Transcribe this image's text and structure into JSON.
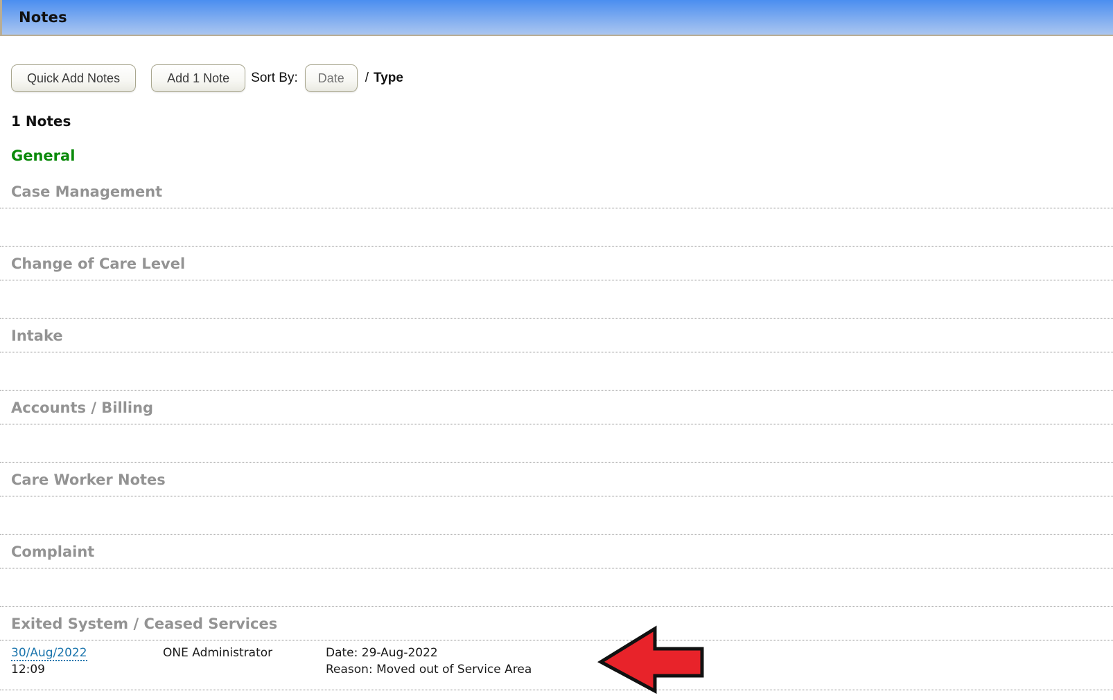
{
  "header": {
    "title": "Notes"
  },
  "toolbar": {
    "quick_add_label": "Quick Add Notes",
    "add_note_label": "Add 1 Note",
    "sort_by_label": "Sort By:",
    "sort_date_label": "Date",
    "sort_separator": "/",
    "sort_type_label": "Type"
  },
  "notes_count": "1 Notes",
  "categories": [
    {
      "label": "General",
      "state": "active"
    },
    {
      "label": "Case Management",
      "state": "empty"
    },
    {
      "label": "Change of Care Level",
      "state": "empty"
    },
    {
      "label": "Intake",
      "state": "empty"
    },
    {
      "label": "Accounts / Billing",
      "state": "empty"
    },
    {
      "label": "Care Worker Notes",
      "state": "empty"
    },
    {
      "label": "Complaint",
      "state": "empty"
    },
    {
      "label": "Exited System / Ceased Services",
      "state": "has-note"
    }
  ],
  "note_entry": {
    "date_link": "30/Aug/2022",
    "time": "12:09",
    "author": "ONE Administrator",
    "detail_line1": "Date: 29-Aug-2022",
    "detail_line2": "Reason: Moved out of Service Area"
  },
  "icons": {
    "arrow_annotation": "left-arrow-icon"
  },
  "colors": {
    "header_gradient_top": "#4b8ef0",
    "header_gradient_bottom": "#abc6f0",
    "header_border_tan": "#b9ad94",
    "category_active_green": "#0a8a0a",
    "category_inactive_gray": "#939393",
    "dotted_line_gray": "#888888",
    "link_blue": "#1b75ad",
    "arrow_red": "#e8232a",
    "arrow_outline_black": "#111111"
  }
}
